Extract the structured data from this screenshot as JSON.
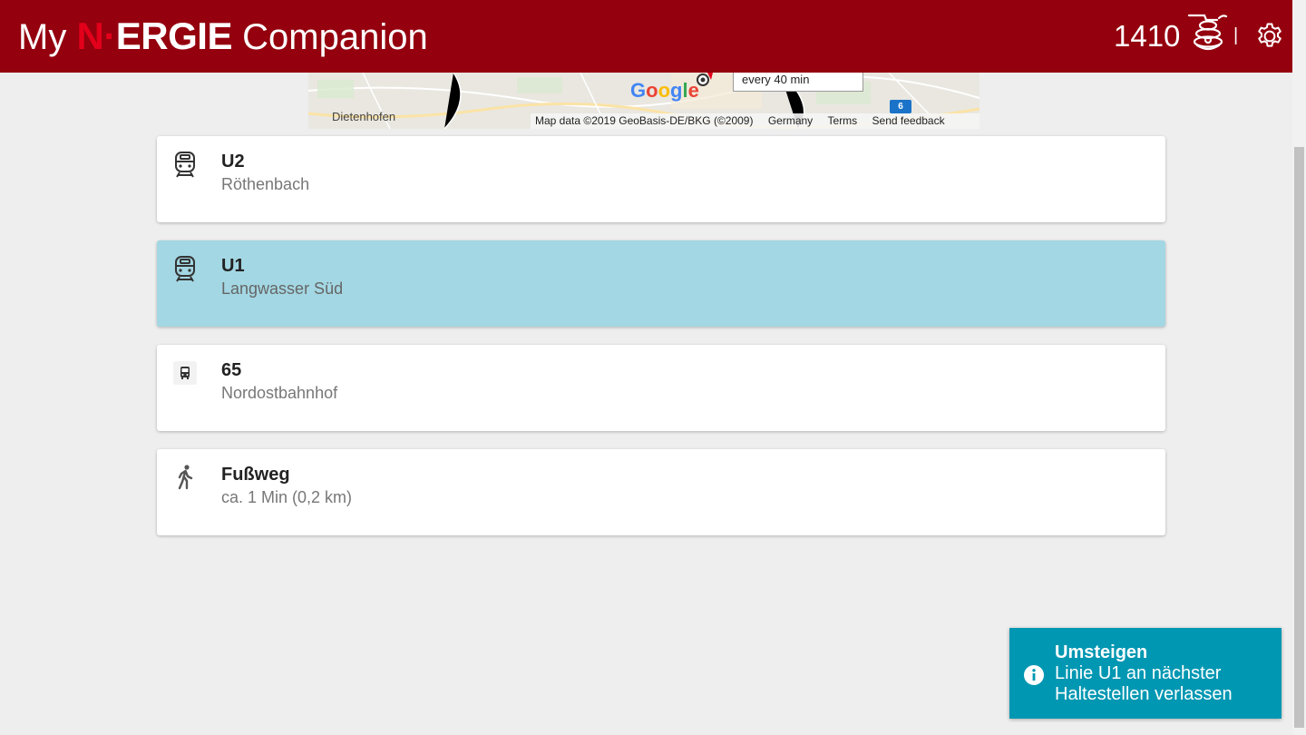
{
  "header": {
    "brand_prefix": "My",
    "brand_logo_n": "N",
    "brand_logo_dot": "·",
    "brand_logo_rest": "ERGIE",
    "brand_suffix": "Companion",
    "score": "1410",
    "separator": "|",
    "icons": [
      "beehive-icon",
      "gear-icon"
    ],
    "colors": {
      "background": "#94000e",
      "logo_accent": "#e3001b"
    }
  },
  "map": {
    "place_label": "Dietenhofen",
    "popup_text": "every 40 min",
    "google_logo": "Google",
    "route_badge": "6",
    "attribution": {
      "map_data": "Map data ©2019 GeoBasis-DE/BKG (©2009)",
      "country": "Germany",
      "terms": "Terms",
      "feedback": "Send feedback"
    }
  },
  "legs": [
    {
      "icon": "subway-icon",
      "line": "U2",
      "destination": "Röthenbach",
      "active": false
    },
    {
      "icon": "subway-icon",
      "line": "U1",
      "destination": "Langwasser Süd",
      "active": true
    },
    {
      "icon": "bus-icon",
      "line": "65",
      "destination": "Nordostbahnhof",
      "active": false
    },
    {
      "icon": "walk-icon",
      "line": "Fußweg",
      "destination": "ca. 1 Min (0,2 km)",
      "active": false
    }
  ],
  "toast": {
    "icon": "info-icon",
    "title": "Umsteigen",
    "message": "Linie U1 an nächster Haltestellen verlassen",
    "color": "#0097b2"
  },
  "colors": {
    "active_leg": "#a3d7e3",
    "page_background": "#eeeeee"
  }
}
